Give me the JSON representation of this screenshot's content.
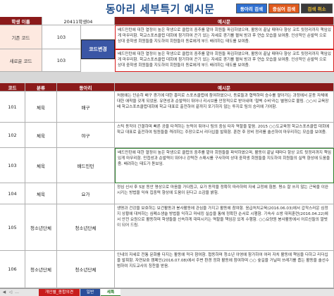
{
  "header": {
    "title": "동아리 세부특기 예시문",
    "buttons": [
      "동아리 검색",
      "증심어 검색",
      "검색 취소"
    ]
  },
  "student": {
    "name_label": "학생 이름",
    "name_value": "20411학생04",
    "example_header": "예시문",
    "old_code_label": "기존 코드",
    "old_code_value": "103",
    "new_code_label": "새로운 코드",
    "new_code_value": "103",
    "code_change_button": "코드변경",
    "old_text": "배드민턴에 대한 열정이 높은 학생으로 클럽의 중추를 맡아 회원들 파김하였으며, 활동이 끝날 때마다 향상 코트 뒷정리까지 책임있게 마무리함. 학교스포츠클럽 대회에 참가하여 끈기 있는 자세로 경기를 펼쳐 방과 후 연습 모습을 보여줌. 인상적인 순발력 으로 상대 중학생 회원들을 지도하여 회원들이 동료에게 부드 배려하는 태도를 보여줌.",
    "new_text": "배드민턴에 대한 열정이 높은 학생으로 클럽의 중추를 맡아 회원들 파김하였으며, 활동이 끝날 때마다 향상 코트 뒷정리까지 책임있게 마무리함. 학교스포츠클럽 대회에 참가하여 끈기 있는 자세로 경기를 펼쳐 방과 후 연습 모습을 보여줌. 인상적인 순발력 으로 상대 중학생 회원들을 지도하여 회원들이 동료에게 부드 배려하는 태도를 보여줌."
  },
  "table": {
    "headers": [
      "코드",
      "분류",
      "동아리",
      "예시문"
    ],
    "rows": [
      {
        "code": "101",
        "category": "체육",
        "club": "배구",
        "text": "처음에는 단순히 배구 경기에 대한 흥미로 스포츠클럽에 참여하였으나, 동료들과 협력하며 승수를 쌓아가는 과정에서 운동 자체에 대한 애착을 갖게 되었음. 유연성과 순발력이 뛰어나 리시브를 안정적으로 받아내며 '철벽 수비'라는 별명으로 불림. ○○시 교육장배 학교스포츠클럽대회에 학교 대표로 출전하여 끝까지 포기하지 않는 투지로 팀의 승리에 기여함."
      },
      {
        "code": "102",
        "category": "체육",
        "club": "야구",
        "text": "스틱 동작이 간결하며 빠른 공을 타격하는 능력이 뛰어나 팀의 중심 타자 역할을 맡음. 2015 ○○도교육청 학교스포츠클럽 대회에 학교 대표로 출전하여 팀원들을 격려하는 주장으로서 리더십을 발휘함. 훈련 후 장비 정리를 솔선하여 마무리하는 모습을 보여줌."
      },
      {
        "code": "103",
        "category": "체육",
        "club": "배드민턴",
        "text": "배드민턴에 대한 열정이 높은 학생으로 클럽의 중추를 맡아 회원들을 파악하였으며, 활동이 끝날 때마다 항상 코트 뒷정리까지 책임있게 마무리함. 민첩성과 순발력이 뛰어나 강력한 스매시를 구사하며 상대 중학생 회원들을 지도하여 회원들의 실력 향상에 도움을 줌. 배려하는 태도가 돋보임."
      },
      {
        "code": "104",
        "category": "체육",
        "club": "요가",
        "text": "정심 신사 후 5분 동안 명상으로 마음을 가다듬고, 요가 동작을 정확히 따라하며 자세 교정에 힘씀. 평소 잘 쓰지 않는 근육을 이완시키는 방법을 익혀 집중력 향상에 도움이 된다고 소감을 밝힘."
      },
      {
        "code": "105",
        "category": "청소년단체",
        "club": "청소년단체",
        "text": "생명과 건강을 보호하는 보건활동과 봉사활동에 관심을 가지고 활동에 참여함. 응급처치교육(2016.06.03)에서 갑작스러운 심정지 상황에 대처하는 심폐소생술 방법을 익히고 마네킹 실습을 통해 정확한 순서로 시행함. 기숙사 소방 대피훈련(2016.04.22)에서 안전 요원으로 활동하며 학생들을 신속하게 대피시키는 역할을 책임감 있게 수행함. ○○요양원 봉사활동에서 어르신들의 말벗이 되어 드림."
      },
      {
        "code": "106",
        "category": "청소년단체",
        "club": "청소년단체",
        "text": "인내의 자세로 전통 문화를 다지는 활동에 적극 참여함. 협동하며 청소년 야영에 참가하여 여러 자치 활동에 책임을 다하고 리더십을 발휘함. 자연보호 캠페인(2016.07.08)에서 주변 환경 정화 활동에 참여하며 ○○ 숲길을 거닐며 쓰레기를 줍는 활동을 솔선수범하여 지도교사의 칭찬을 받음."
      }
    ]
  },
  "sheet_tabs": [
    "개인별_종합의견",
    "일반",
    "세특"
  ]
}
